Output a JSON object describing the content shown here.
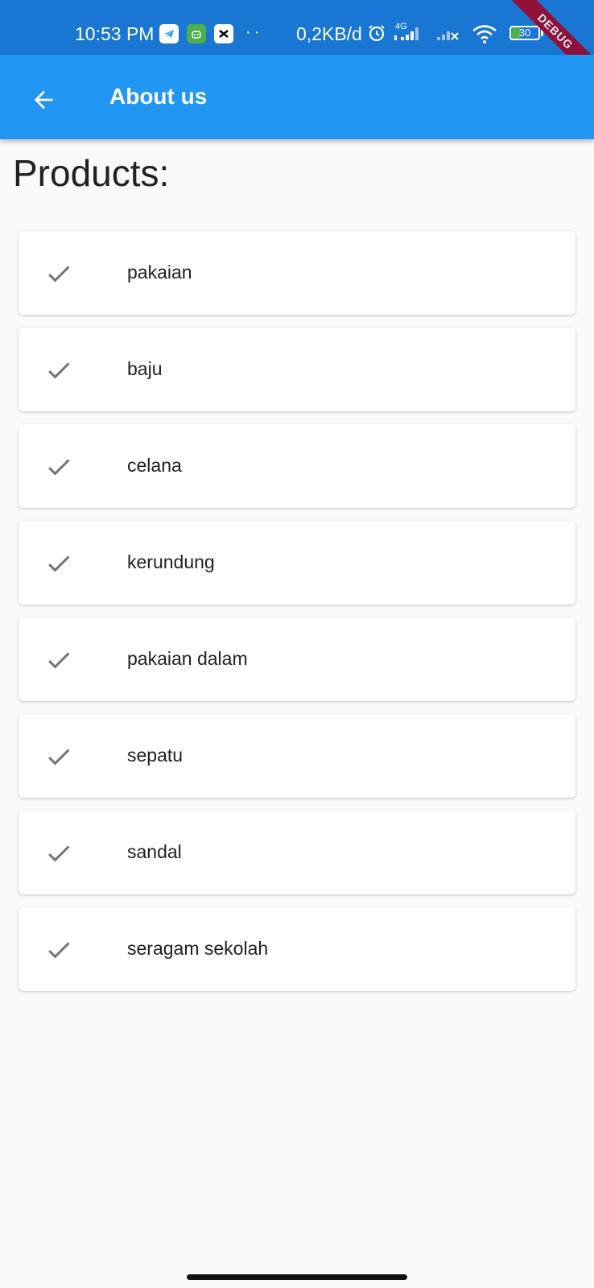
{
  "status_bar": {
    "time": "10:53 PM",
    "net_speed": "0,2KB/d",
    "network_type": "4G",
    "battery": "30",
    "icons": [
      "telegram-icon",
      "bot-icon",
      "capcut-icon",
      "more-dots-icon",
      "alarm-icon",
      "signal-icon",
      "signal-icon",
      "wifi-icon",
      "battery-icon"
    ],
    "more_dots": "··"
  },
  "debug_banner": "DEBUG",
  "app_bar": {
    "back_icon": "arrow-back-icon",
    "title": "About us",
    "color": "#2196f3"
  },
  "section_title": "Products:",
  "products": [
    {
      "icon": "check-icon",
      "label": "pakaian"
    },
    {
      "icon": "check-icon",
      "label": "baju"
    },
    {
      "icon": "check-icon",
      "label": "celana"
    },
    {
      "icon": "check-icon",
      "label": "kerundung"
    },
    {
      "icon": "check-icon",
      "label": "pakaian dalam"
    },
    {
      "icon": "check-icon",
      "label": "sepatu"
    },
    {
      "icon": "check-icon",
      "label": "sandal"
    },
    {
      "icon": "check-icon",
      "label": "seragam sekolah"
    }
  ]
}
